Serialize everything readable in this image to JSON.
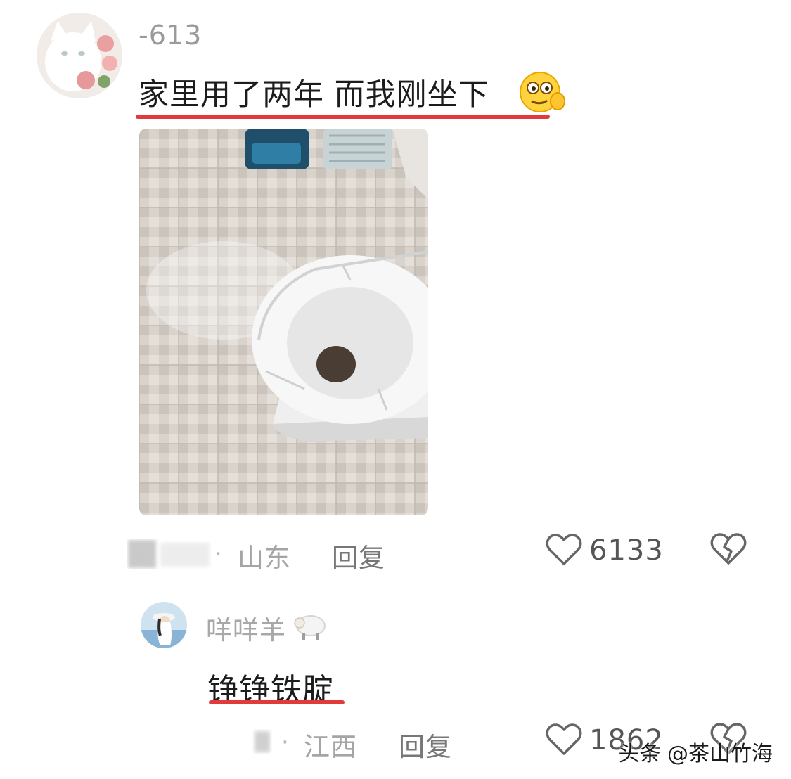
{
  "comment": {
    "username": "-613",
    "text": "家里用了两年 而我刚坐下",
    "location_sep": "·",
    "location": "山东",
    "reply_label": "回复",
    "like_count": "6133"
  },
  "reply": {
    "username": "咩咩羊",
    "text": "铮铮铁腚",
    "location_sep": "·",
    "location": "江西",
    "reply_label": "回复",
    "like_count": "1862"
  },
  "watermark": "头条 @茶山竹海",
  "icons": {
    "emoji": "peek-emoji-icon",
    "username_badge": "sheep-emoji-icon",
    "like": "heart-outline-icon",
    "dislike": "broken-heart-icon"
  },
  "colors": {
    "underline": "#e23a3a",
    "username": "#9a9a9a",
    "text": "#1c1c1c"
  }
}
